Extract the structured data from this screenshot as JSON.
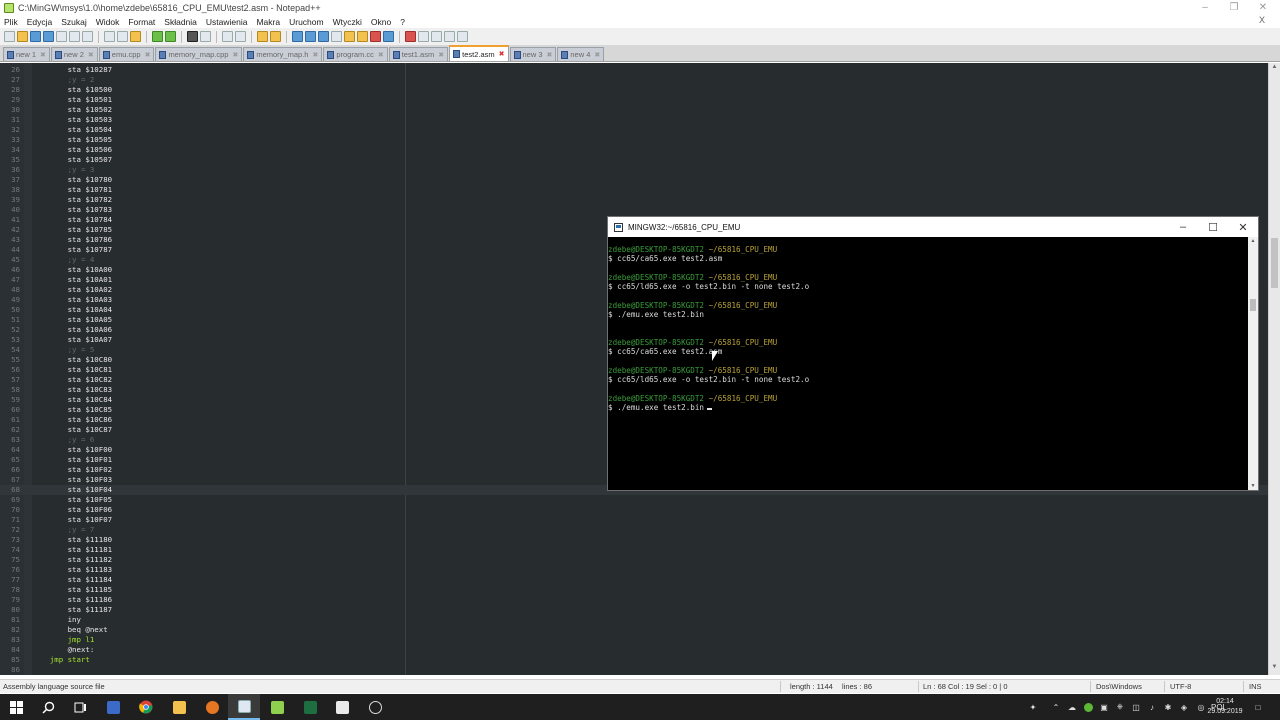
{
  "notepad": {
    "title": "C:\\MinGW\\msys\\1.0\\home\\zdebe\\65816_CPU_EMU\\test2.asm - Notepad++",
    "menu": [
      "Plik",
      "Edycja",
      "Szukaj",
      "Widok",
      "Format",
      "Składnia",
      "Ustawienia",
      "Makra",
      "Uruchom",
      "Wtyczki",
      "Okno",
      "?"
    ],
    "menu_close": "X",
    "tabs": [
      {
        "label": "new 1",
        "active": false
      },
      {
        "label": "new 2",
        "active": false
      },
      {
        "label": "emu.cpp",
        "active": false
      },
      {
        "label": "memory_map.cpp",
        "active": false
      },
      {
        "label": "memory_map.h",
        "active": false
      },
      {
        "label": "program.cc",
        "active": false
      },
      {
        "label": "test1.asm",
        "active": false
      },
      {
        "label": "test2.asm",
        "active": true
      },
      {
        "label": "new 3",
        "active": false
      },
      {
        "label": "new 4",
        "active": false
      }
    ],
    "editor": {
      "current_line": 68,
      "lines": [
        {
          "n": "26",
          "text": "        sta $10287",
          "type": "code"
        },
        {
          "n": "27",
          "text": "        ;y = 2",
          "type": "comment"
        },
        {
          "n": "28",
          "text": "        sta $10500",
          "type": "code"
        },
        {
          "n": "29",
          "text": "        sta $10501",
          "type": "code"
        },
        {
          "n": "30",
          "text": "        sta $10502",
          "type": "code"
        },
        {
          "n": "31",
          "text": "        sta $10503",
          "type": "code"
        },
        {
          "n": "32",
          "text": "        sta $10504",
          "type": "code"
        },
        {
          "n": "33",
          "text": "        sta $10505",
          "type": "code"
        },
        {
          "n": "34",
          "text": "        sta $10506",
          "type": "code"
        },
        {
          "n": "35",
          "text": "        sta $10507",
          "type": "code"
        },
        {
          "n": "36",
          "text": "        ;y = 3",
          "type": "comment"
        },
        {
          "n": "37",
          "text": "        sta $10780",
          "type": "code"
        },
        {
          "n": "38",
          "text": "        sta $10781",
          "type": "code"
        },
        {
          "n": "39",
          "text": "        sta $10782",
          "type": "code"
        },
        {
          "n": "40",
          "text": "        sta $10783",
          "type": "code"
        },
        {
          "n": "41",
          "text": "        sta $10784",
          "type": "code"
        },
        {
          "n": "42",
          "text": "        sta $10785",
          "type": "code"
        },
        {
          "n": "43",
          "text": "        sta $10786",
          "type": "code"
        },
        {
          "n": "44",
          "text": "        sta $10787",
          "type": "code"
        },
        {
          "n": "45",
          "text": "        ;y = 4",
          "type": "comment"
        },
        {
          "n": "46",
          "text": "        sta $10A00",
          "type": "code"
        },
        {
          "n": "47",
          "text": "        sta $10A01",
          "type": "code"
        },
        {
          "n": "48",
          "text": "        sta $10A02",
          "type": "code"
        },
        {
          "n": "49",
          "text": "        sta $10A03",
          "type": "code"
        },
        {
          "n": "50",
          "text": "        sta $10A04",
          "type": "code"
        },
        {
          "n": "51",
          "text": "        sta $10A05",
          "type": "code"
        },
        {
          "n": "52",
          "text": "        sta $10A06",
          "type": "code"
        },
        {
          "n": "53",
          "text": "        sta $10A07",
          "type": "code"
        },
        {
          "n": "54",
          "text": "        ;y = 5",
          "type": "comment"
        },
        {
          "n": "55",
          "text": "        sta $10C80",
          "type": "code"
        },
        {
          "n": "56",
          "text": "        sta $10C81",
          "type": "code"
        },
        {
          "n": "57",
          "text": "        sta $10C82",
          "type": "code"
        },
        {
          "n": "58",
          "text": "        sta $10C83",
          "type": "code"
        },
        {
          "n": "59",
          "text": "        sta $10C84",
          "type": "code"
        },
        {
          "n": "60",
          "text": "        sta $10C85",
          "type": "code"
        },
        {
          "n": "61",
          "text": "        sta $10C86",
          "type": "code"
        },
        {
          "n": "62",
          "text": "        sta $10C87",
          "type": "code"
        },
        {
          "n": "63",
          "text": "        ;y = 6",
          "type": "comment"
        },
        {
          "n": "64",
          "text": "        sta $10F00",
          "type": "code"
        },
        {
          "n": "65",
          "text": "        sta $10F01",
          "type": "code"
        },
        {
          "n": "66",
          "text": "        sta $10F02",
          "type": "code"
        },
        {
          "n": "67",
          "text": "        sta $10F03",
          "type": "code"
        },
        {
          "n": "68",
          "text": "        sta $10F04",
          "type": "code"
        },
        {
          "n": "69",
          "text": "        sta $10F05",
          "type": "code"
        },
        {
          "n": "70",
          "text": "        sta $10F06",
          "type": "code"
        },
        {
          "n": "71",
          "text": "        sta $10F07",
          "type": "code"
        },
        {
          "n": "72",
          "text": "        ;y = 7",
          "type": "comment"
        },
        {
          "n": "73",
          "text": "        sta $11180",
          "type": "code"
        },
        {
          "n": "74",
          "text": "        sta $11181",
          "type": "code"
        },
        {
          "n": "75",
          "text": "        sta $11182",
          "type": "code"
        },
        {
          "n": "76",
          "text": "        sta $11183",
          "type": "code"
        },
        {
          "n": "77",
          "text": "        sta $11184",
          "type": "code"
        },
        {
          "n": "78",
          "text": "        sta $11185",
          "type": "code"
        },
        {
          "n": "79",
          "text": "        sta $11186",
          "type": "code"
        },
        {
          "n": "80",
          "text": "        sta $11187",
          "type": "code"
        },
        {
          "n": "81",
          "text": "        iny",
          "type": "code"
        },
        {
          "n": "82",
          "text": "        beq @next",
          "type": "code"
        },
        {
          "n": "83",
          "text": "        jmp l1",
          "type": "jmp"
        },
        {
          "n": "84",
          "text": "        @next:",
          "type": "code"
        },
        {
          "n": "85",
          "text": "    jmp start",
          "type": "jmp"
        },
        {
          "n": "86",
          "text": "",
          "type": "code"
        }
      ]
    },
    "status": {
      "file_type": "Assembly language source file",
      "length": "length : 1144",
      "lines": "lines : 86",
      "position": "Ln : 68    Col : 19    Sel : 0 | 0",
      "eol": "Dos\\Windows",
      "encoding": "UTF-8",
      "mode": "INS"
    }
  },
  "terminal": {
    "title": "MINGW32:~/65816_CPU_EMU",
    "lines": [
      {
        "kind": "prompt",
        "user": "zdebe@DESKTOP-85KGDT2",
        "path": "~/65816_CPU_EMU"
      },
      {
        "kind": "cmd",
        "text": "$ cc65/ca65.exe test2.asm"
      },
      {
        "kind": "blank"
      },
      {
        "kind": "prompt",
        "user": "zdebe@DESKTOP-85KGDT2",
        "path": "~/65816_CPU_EMU"
      },
      {
        "kind": "cmd",
        "text": "$ cc65/ld65.exe -o test2.bin -t none test2.o"
      },
      {
        "kind": "blank"
      },
      {
        "kind": "prompt",
        "user": "zdebe@DESKTOP-85KGDT2",
        "path": "~/65816_CPU_EMU"
      },
      {
        "kind": "cmd",
        "text": "$ ./emu.exe test2.bin"
      },
      {
        "kind": "blank"
      },
      {
        "kind": "blank"
      },
      {
        "kind": "prompt",
        "user": "zdebe@DESKTOP-85KGDT2",
        "path": "~/65816_CPU_EMU"
      },
      {
        "kind": "cmd",
        "text": "$ cc65/ca65.exe test2.asm"
      },
      {
        "kind": "blank"
      },
      {
        "kind": "prompt",
        "user": "zdebe@DESKTOP-85KGDT2",
        "path": "~/65816_CPU_EMU"
      },
      {
        "kind": "cmd",
        "text": "$ cc65/ld65.exe -o test2.bin -t none test2.o"
      },
      {
        "kind": "blank"
      },
      {
        "kind": "prompt",
        "user": "zdebe@DESKTOP-85KGDT2",
        "path": "~/65816_CPU_EMU"
      },
      {
        "kind": "cmd_cursor",
        "text": "$ ./emu.exe test2.bin"
      }
    ]
  },
  "taskbar": {
    "language": "POL",
    "time": "02:14",
    "date": "29.09.2019",
    "apps": [
      "start-icon",
      "search-icon",
      "task-view-icon",
      "app-icon",
      "chrome-icon",
      "folder-icon",
      "app-icon",
      "terminal-icon",
      "notepadpp-icon",
      "excel-icon",
      "calculator-icon",
      "settings-icon"
    ]
  },
  "colors": {
    "editor_bg": "#272c2f",
    "keyword_jmp": "#a6e22e",
    "comment": "#5f6a70",
    "prompt_user": "#3b9c3b",
    "prompt_path": "#b9a33a",
    "active_tab_accent": "#f0a030"
  }
}
